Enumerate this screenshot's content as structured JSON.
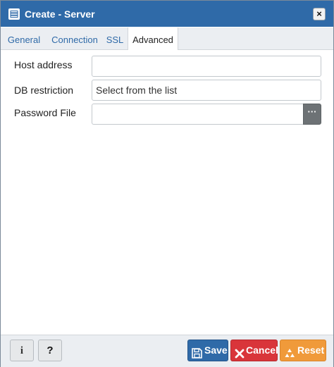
{
  "dialog": {
    "title": "Create - Server",
    "close_label": "×"
  },
  "tabs": [
    {
      "label": "General",
      "active": false
    },
    {
      "label": "Connection",
      "active": false
    },
    {
      "label": "SSL",
      "active": false
    },
    {
      "label": "Advanced",
      "active": true
    }
  ],
  "form": {
    "host_address": {
      "label": "Host address",
      "value": ""
    },
    "db_restriction": {
      "label": "DB restriction",
      "placeholder": "Select from the list"
    },
    "password_file": {
      "label": "Password File",
      "value": "",
      "browse_label": "···"
    }
  },
  "footer": {
    "info_label": "i",
    "help_label": "?",
    "save_label": "Save",
    "cancel_label": "Cancel",
    "reset_label": "Reset"
  },
  "colors": {
    "titlebar": "#2f6aa8",
    "save": "#2f6aa8",
    "cancel": "#d9353a",
    "reset": "#f09a3a"
  },
  "icons": {
    "title": "server-icon",
    "save": "floppy-disk-icon",
    "cancel": "x-icon",
    "reset": "recycle-icon",
    "info": "info-icon",
    "help": "question-icon"
  }
}
